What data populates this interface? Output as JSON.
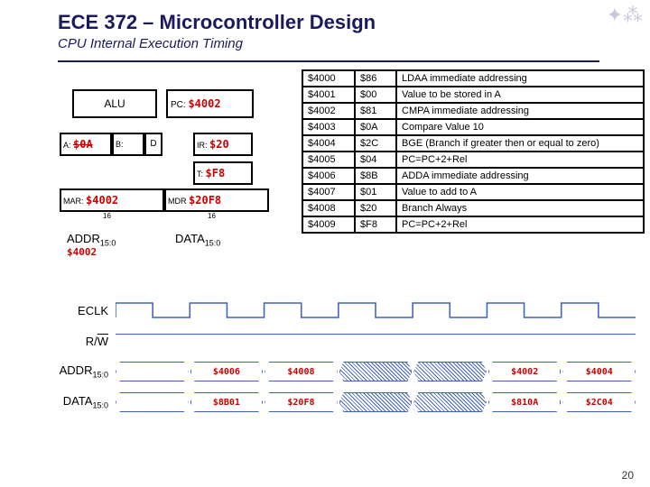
{
  "page": {
    "title": "ECE 372 – Microcontroller Design",
    "subtitle": "CPU Internal Execution Timing",
    "pagenum": "20"
  },
  "diagram": {
    "alu": "ALU",
    "pc_label": "PC:",
    "pc_value": "$4002",
    "a_label": "A:",
    "a_value": "$0A",
    "b_label": "B:",
    "d_label": "D",
    "ir_label": "IR:",
    "ir_value": "$20",
    "t_label": "T:",
    "t_value": "$F8",
    "mar_label": "MAR:",
    "mar_value": "$4002",
    "mdr_label": "MDR",
    "mdr_value": "$20F8",
    "bus16a": "16",
    "bus16b": "16",
    "addrbus": "ADDR",
    "addrbus_sub": "15:0",
    "addrbus_val": "$4002",
    "databus": "DATA",
    "databus_sub": "15:0"
  },
  "mem": [
    {
      "addr": "$4000",
      "op": "$86",
      "desc": "LDAA immediate addressing"
    },
    {
      "addr": "$4001",
      "op": "$00",
      "desc": "Value to be stored in A"
    },
    {
      "addr": "$4002",
      "op": "$81",
      "desc": "CMPA immediate addressing"
    },
    {
      "addr": "$4003",
      "op": "$0A",
      "desc": "Compare Value 10"
    },
    {
      "addr": "$4004",
      "op": "$2C",
      "desc": "BGE (Branch if greater then or equal to zero)"
    },
    {
      "addr": "$4005",
      "op": "$04",
      "desc": "PC=PC+2+Rel"
    },
    {
      "addr": "$4006",
      "op": "$8B",
      "desc": "ADDA immediate addressing"
    },
    {
      "addr": "$4007",
      "op": "$01",
      "desc": "Value to add to A"
    },
    {
      "addr": "$4008",
      "op": "$20",
      "desc": "Branch Always"
    },
    {
      "addr": "$4009",
      "op": "$F8",
      "desc": "PC=PC+2+Rel"
    }
  ],
  "waves": {
    "eclk": "ECLK",
    "rw": "R/W",
    "addr_lbl": "ADDR",
    "addr_sub": "15:0",
    "data_lbl": "DATA",
    "data_sub": "15:0",
    "addr_vals": [
      "",
      "$4006",
      "$4008",
      "",
      "",
      "$4002",
      "$4004"
    ],
    "addr_hatch": [
      false,
      false,
      false,
      true,
      true,
      false,
      false
    ],
    "data_vals": [
      "",
      "$8B01",
      "$20F8",
      "",
      "",
      "$810A",
      "$2C04"
    ],
    "data_hatch": [
      false,
      false,
      false,
      true,
      true,
      false,
      false
    ]
  }
}
